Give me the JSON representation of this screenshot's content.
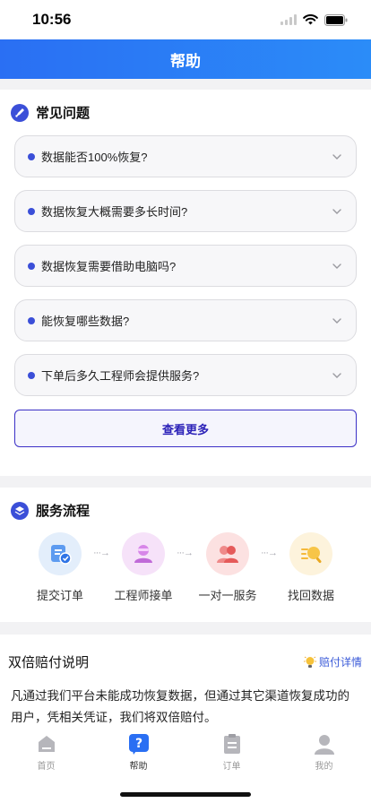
{
  "status": {
    "time": "10:56"
  },
  "header": {
    "title": "帮助"
  },
  "faq": {
    "title": "常见问题",
    "items": [
      {
        "question": "数据能否100%恢复?"
      },
      {
        "question": "数据恢复大概需要多长时间?"
      },
      {
        "question": "数据恢复需要借助电脑吗?"
      },
      {
        "question": "能恢复哪些数据?"
      },
      {
        "question": "下单后多久工程师会提供服务?"
      }
    ],
    "more_label": "查看更多"
  },
  "flow": {
    "title": "服务流程",
    "steps": [
      {
        "label": "提交订单",
        "icon": "order-submit-icon",
        "color": "#e3eefb"
      },
      {
        "label": "工程师接单",
        "icon": "engineer-icon",
        "color": "#f6e2f9"
      },
      {
        "label": "一对一服务",
        "icon": "one-on-one-icon",
        "color": "#fce1e1"
      },
      {
        "label": "找回数据",
        "icon": "search-data-icon",
        "color": "#fdf3dc"
      }
    ]
  },
  "compensation": {
    "title": "双倍赔付说明",
    "link_label": "赔付详情",
    "text": "凡通过我们平台未能成功恢复数据，但通过其它渠道恢复成功的用户，凭相关凭证，我们将双倍赔付。"
  },
  "tabbar": {
    "items": [
      {
        "label": "首页",
        "icon": "home-icon",
        "active": false
      },
      {
        "label": "帮助",
        "icon": "help-icon",
        "active": true
      },
      {
        "label": "订单",
        "icon": "order-icon",
        "active": false
      },
      {
        "label": "我的",
        "icon": "profile-icon",
        "active": false
      }
    ]
  },
  "colors": {
    "accent": "#2a6ff3",
    "indigo": "#3b4fd8",
    "inactive": "#999999"
  }
}
